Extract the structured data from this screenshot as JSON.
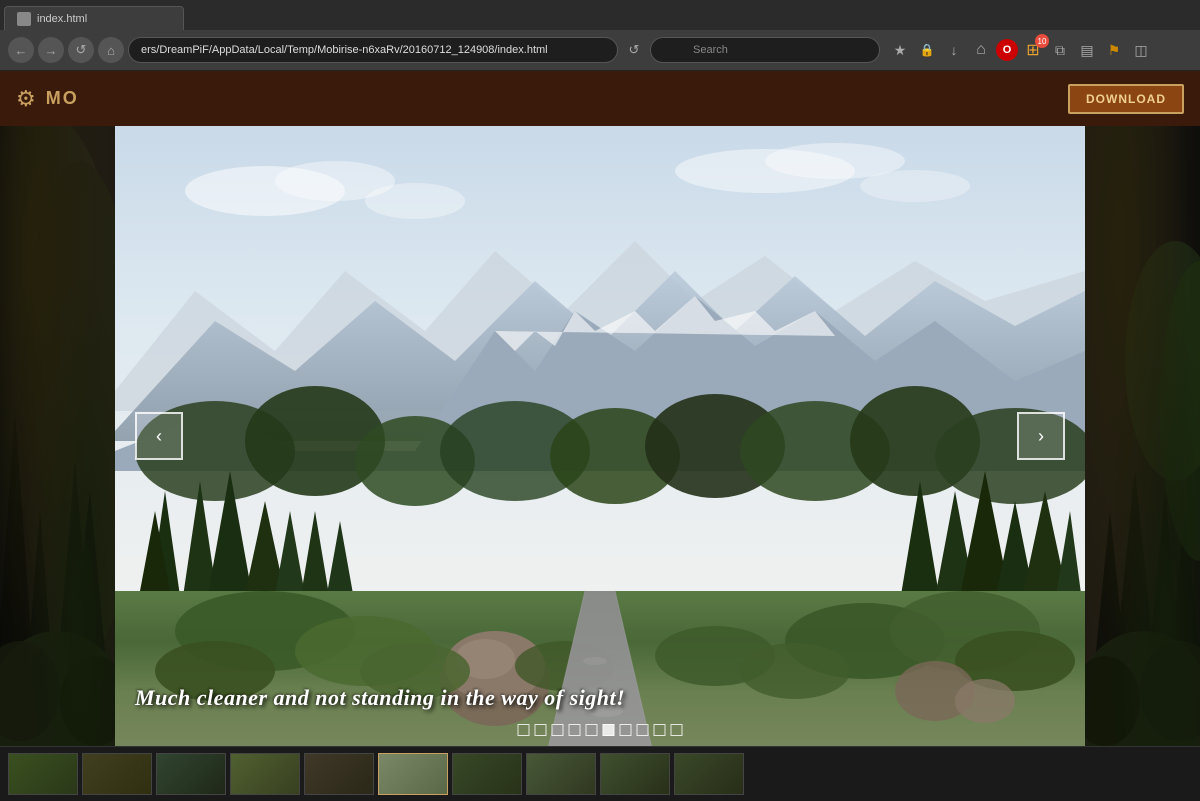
{
  "browser": {
    "url": "ers/DreamPiF/AppData/Local/Temp/Mobirise-n6xaRv/20160712_124908/index.html",
    "search_placeholder": "Search",
    "tab_label": "index.html",
    "notification_count": "10"
  },
  "app": {
    "title": "MO",
    "download_label": "DOWNLOAD",
    "gear_icon": "⚙"
  },
  "slider": {
    "caption": "Much cleaner and not standing in the way of sight!",
    "prev_label": "‹",
    "next_label": "›",
    "dots": [
      {
        "active": false
      },
      {
        "active": false
      },
      {
        "active": false
      },
      {
        "active": false
      },
      {
        "active": false
      },
      {
        "active": true
      },
      {
        "active": false
      },
      {
        "active": false
      },
      {
        "active": false
      },
      {
        "active": false
      }
    ],
    "current_index": 5,
    "total": 10
  },
  "icons": {
    "back": "←",
    "forward": "→",
    "refresh": "↺",
    "home": "⌂",
    "search": "🔍",
    "star": "★",
    "lock": "🔒",
    "download_arrow": "↓",
    "menu": "☰",
    "gear": "⚙",
    "prev_arrow": "❮",
    "next_arrow": "❯"
  }
}
